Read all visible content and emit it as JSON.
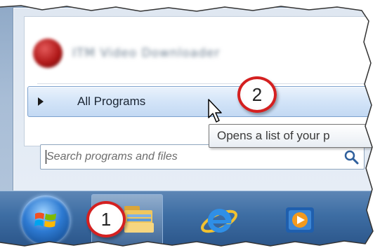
{
  "start_menu": {
    "recent_item_label": "ITM Video Downloader",
    "all_programs_label": "All Programs",
    "search": {
      "placeholder": "Search programs and files",
      "value": ""
    }
  },
  "tooltip": {
    "text": "Opens a list of your p"
  },
  "callouts": {
    "one": "1",
    "two": "2"
  },
  "icons": {
    "all_programs_arrow": "triangle-right-icon",
    "search": "magnifier-icon",
    "cursor": "arrow-pointer-icon",
    "start": "windows-logo-icon",
    "explorer": "folder-icon",
    "ie": "internet-explorer-icon",
    "media": "media-player-icon"
  },
  "colors": {
    "callout_ring": "#d42020",
    "taskbar": "#3e6ea4",
    "all_programs_highlight": "#d3e4f8"
  }
}
